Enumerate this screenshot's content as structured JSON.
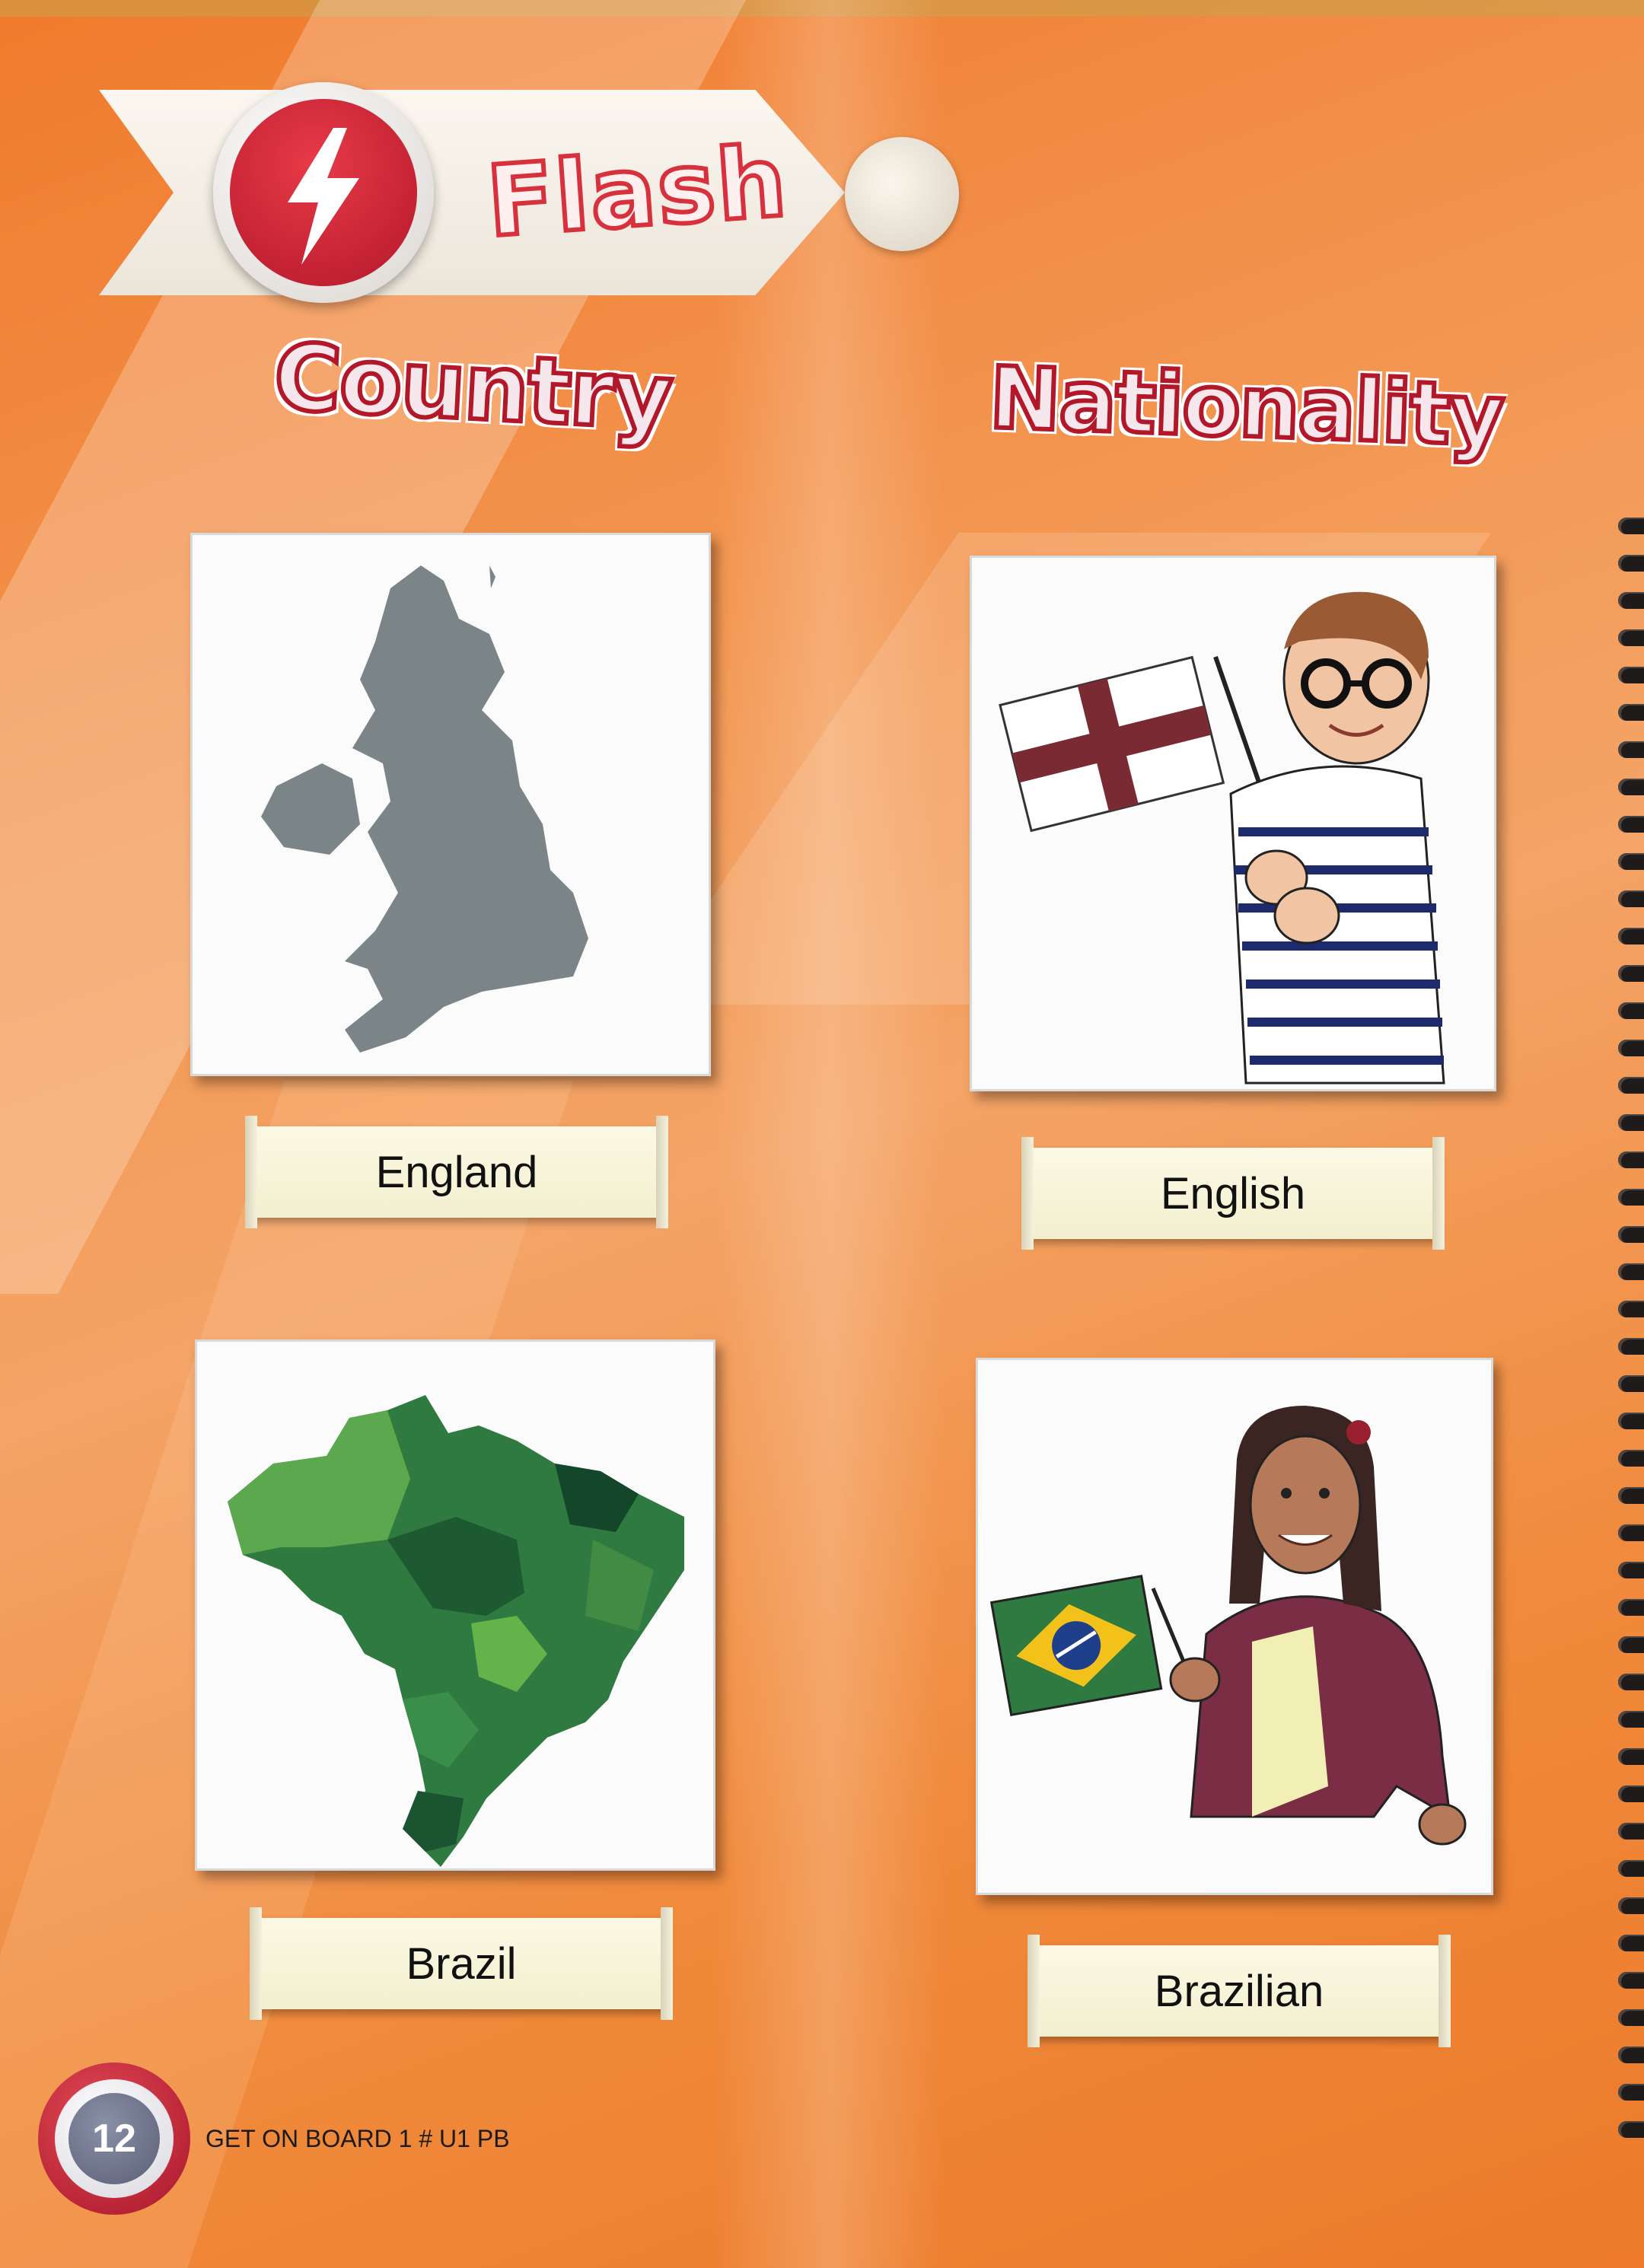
{
  "header": {
    "title": "Flash"
  },
  "columns": {
    "left": "Country",
    "right": "Nationality"
  },
  "cards": [
    {
      "label": "England"
    },
    {
      "label": "English"
    },
    {
      "label": "Brazil"
    },
    {
      "label": "Brazilian"
    }
  ],
  "footer": {
    "page_number": "12",
    "book": "GET ON BOARD 1 # U1 PB"
  }
}
